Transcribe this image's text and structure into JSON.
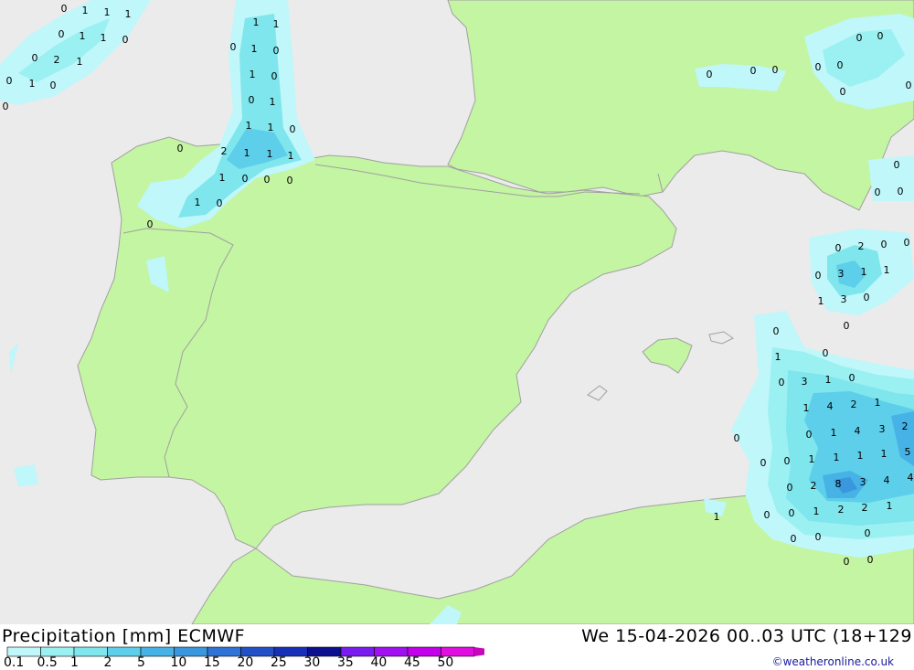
{
  "header": {
    "title_left": "Precipitation [mm] ECMWF",
    "title_right": "We 15-04-2026 00..03 UTC (18+129",
    "credit": "©weatheronline.co.uk"
  },
  "colors": {
    "sea": "#ebebeb",
    "land": "#c4f5a2",
    "border": "#a0a0a0",
    "legend": [
      "#bff7fa",
      "#9bf0f2",
      "#7ee6ec",
      "#5dcfea",
      "#46b2e6",
      "#3a96dd",
      "#2f73d6",
      "#2350c8",
      "#1830b8",
      "#0c1090",
      "#7a1cf0",
      "#a010f0",
      "#c200ea",
      "#e00ee0",
      "#c40ab8"
    ]
  },
  "legend": {
    "labels": [
      "0.1",
      "0.5",
      "1",
      "2",
      "5",
      "10",
      "15",
      "20",
      "25",
      "30",
      "35",
      "40",
      "45",
      "50"
    ]
  },
  "precip_values": [
    "0",
    "1",
    "1",
    "1",
    "0",
    "1",
    "1",
    "0",
    "0",
    "2",
    "1",
    "0",
    "1",
    "0",
    "0",
    "1",
    "1",
    "0",
    "1",
    "0",
    "1",
    "0",
    "0",
    "1",
    "1",
    "1",
    "0",
    "0",
    "2",
    "1",
    "1",
    "1",
    "1",
    "0",
    "0",
    "0",
    "1",
    "0",
    "0",
    "0",
    "0",
    "0",
    "0",
    "0",
    "0",
    "0",
    "0",
    "0",
    "0",
    "0",
    "0",
    "0",
    "2",
    "0",
    "0",
    "0",
    "3",
    "1",
    "1",
    "1",
    "3",
    "0",
    "0",
    "0",
    "1",
    "0",
    "0",
    "3",
    "1",
    "0",
    "1",
    "4",
    "2",
    "1",
    "0",
    "1",
    "4",
    "3",
    "2",
    "0",
    "0",
    "0",
    "1",
    "1",
    "1",
    "1",
    "5",
    "0",
    "2",
    "8",
    "3",
    "4",
    "4",
    "0",
    "0",
    "1",
    "2",
    "2",
    "1",
    "1",
    "0",
    "0",
    "0",
    "0",
    "0"
  ]
}
